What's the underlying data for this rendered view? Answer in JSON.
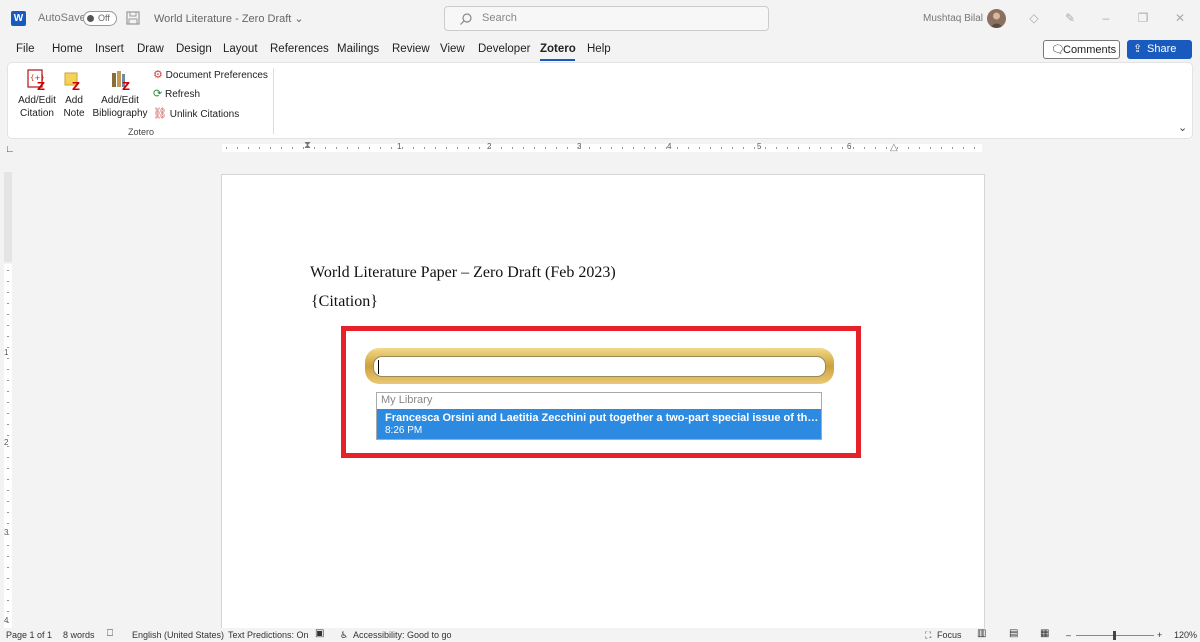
{
  "titlebar": {
    "app_icon_letter": "W",
    "autosave_label": "AutoSave",
    "autosave_state": "Off",
    "doc_title": "World Literature - Zero Draft",
    "search_placeholder": "Search",
    "username": "Mushtaq Bilal"
  },
  "menu": {
    "tabs": [
      "File",
      "Home",
      "Insert",
      "Draw",
      "Design",
      "Layout",
      "References",
      "Mailings",
      "Review",
      "View",
      "Developer",
      "Zotero",
      "Help"
    ],
    "active_tab": "Zotero",
    "comments_label": "Comments",
    "share_label": "Share"
  },
  "ribbon": {
    "add_edit_citation": [
      "Add/Edit",
      "Citation"
    ],
    "add_note": [
      "Add",
      "Note"
    ],
    "add_edit_bibliography": [
      "Add/Edit",
      "Bibliography"
    ],
    "document_preferences": "Document Preferences",
    "refresh": "Refresh",
    "unlink_citations": "Unlink Citations",
    "group_label": "Zotero"
  },
  "ruler": {
    "numbers": [
      "1",
      "2",
      "3",
      "4",
      "5",
      "6"
    ],
    "vertical_numbers": [
      "1",
      "2",
      "3",
      "4"
    ]
  },
  "document": {
    "heading": "World Literature Paper – Zero Draft (Feb 2023)",
    "citation_placeholder": "{Citation}"
  },
  "zotero_quick_format": {
    "input_value": "",
    "results_header": "My Library",
    "result_title": "Francesca Orsini and Laetitia Zecchini put together a two-part special issue of th…",
    "result_time": "8:26 PM"
  },
  "statusbar": {
    "page": "Page 1 of 1",
    "words": "8 words",
    "language": "English (United States)",
    "text_predictions": "Text Predictions: On",
    "accessibility": "Accessibility: Good to go",
    "focus": "Focus",
    "zoom": "120%"
  },
  "colors": {
    "accent": "#185abd",
    "highlight_border": "#e52229",
    "selected_result": "#2c8ae0"
  }
}
